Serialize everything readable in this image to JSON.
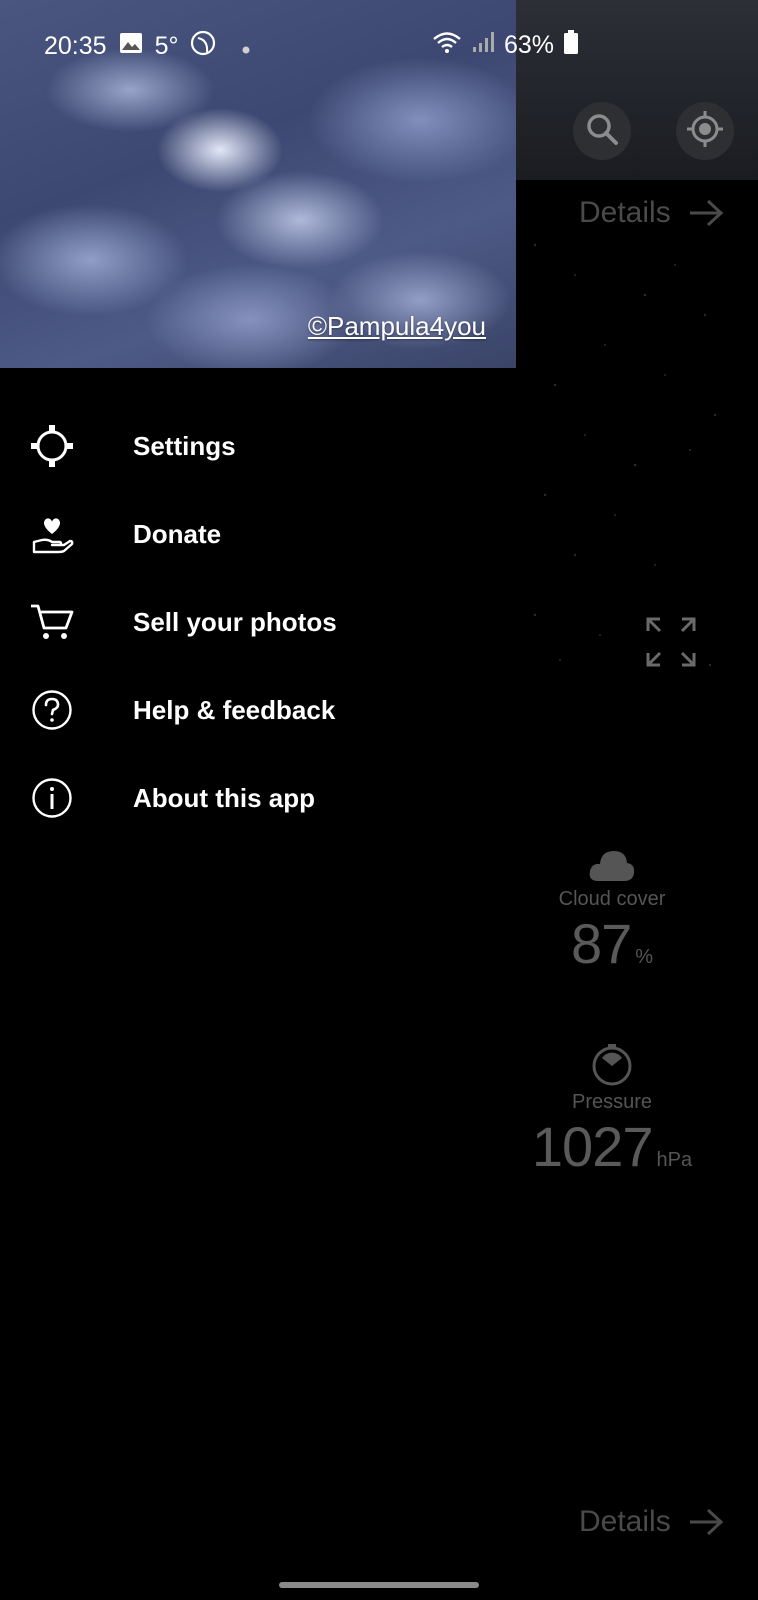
{
  "status_bar": {
    "time": "20:35",
    "temperature": "5°",
    "battery": "63%",
    "icons": [
      "gallery-icon",
      "moon-icon",
      "dot-icon",
      "wifi-icon",
      "signal-icon",
      "battery-icon"
    ]
  },
  "drawer": {
    "header_credit": "©Pampula4you",
    "items": [
      {
        "label": "Settings",
        "icon": "gear-icon"
      },
      {
        "label": "Donate",
        "icon": "donate-hand-heart-icon"
      },
      {
        "label": "Sell your photos",
        "icon": "cart-icon"
      },
      {
        "label": "Help & feedback",
        "icon": "help-icon"
      },
      {
        "label": "About this app",
        "icon": "info-icon"
      }
    ]
  },
  "background_app": {
    "details_label_top": "Details",
    "details_label_bottom": "Details",
    "cloud_cover": {
      "label": "Cloud cover",
      "value": "87",
      "unit": "%"
    },
    "pressure": {
      "label": "Pressure",
      "value": "1027",
      "unit": "hPa"
    },
    "colors": {
      "dimmed_text": "#4a4a4a",
      "drawer_bg": "#000000"
    }
  }
}
